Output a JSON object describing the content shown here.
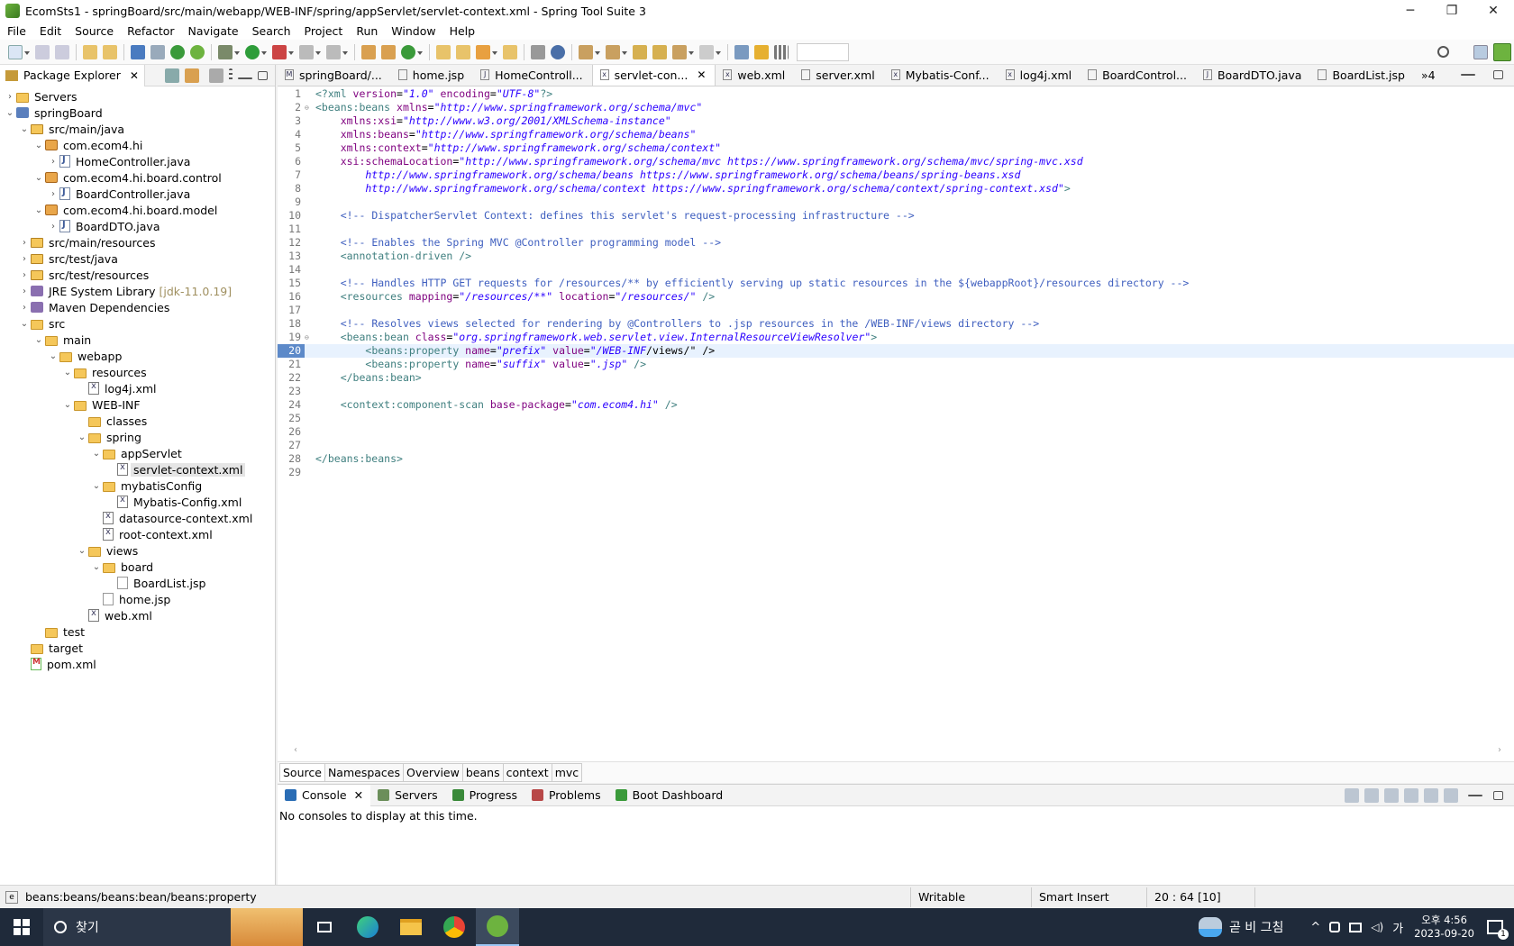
{
  "window": {
    "title": "EcomSts1 - springBoard/src/main/webapp/WEB-INF/spring/appServlet/servlet-context.xml - Spring Tool Suite 3",
    "minimize": "─",
    "maximize": "❐",
    "close": "✕"
  },
  "menu": [
    "File",
    "Edit",
    "Source",
    "Refactor",
    "Navigate",
    "Search",
    "Project",
    "Run",
    "Window",
    "Help"
  ],
  "explorer": {
    "title": "Package Explorer",
    "tree": [
      {
        "label": "Servers",
        "depth": 0,
        "twisty": "›",
        "icon": "folder"
      },
      {
        "label": "springBoard",
        "depth": 0,
        "twisty": "⌄",
        "icon": "proj"
      },
      {
        "label": "src/main/java",
        "depth": 1,
        "twisty": "⌄",
        "icon": "pkgfolder"
      },
      {
        "label": "com.ecom4.hi",
        "depth": 2,
        "twisty": "⌄",
        "icon": "pkg"
      },
      {
        "label": "HomeController.java",
        "depth": 3,
        "twisty": "›",
        "icon": "java"
      },
      {
        "label": "com.ecom4.hi.board.control",
        "depth": 2,
        "twisty": "⌄",
        "icon": "pkg"
      },
      {
        "label": "BoardController.java",
        "depth": 3,
        "twisty": "›",
        "icon": "java"
      },
      {
        "label": "com.ecom4.hi.board.model",
        "depth": 2,
        "twisty": "⌄",
        "icon": "pkg"
      },
      {
        "label": "BoardDTO.java",
        "depth": 3,
        "twisty": "›",
        "icon": "java"
      },
      {
        "label": "src/main/resources",
        "depth": 1,
        "twisty": "›",
        "icon": "pkgfolder"
      },
      {
        "label": "src/test/java",
        "depth": 1,
        "twisty": "›",
        "icon": "pkgfolder"
      },
      {
        "label": "src/test/resources",
        "depth": 1,
        "twisty": "›",
        "icon": "pkgfolder"
      },
      {
        "label": "JRE System Library",
        "dim": " [jdk-11.0.19]",
        "depth": 1,
        "twisty": "›",
        "icon": "lib"
      },
      {
        "label": "Maven Dependencies",
        "depth": 1,
        "twisty": "›",
        "icon": "lib"
      },
      {
        "label": "src",
        "depth": 1,
        "twisty": "⌄",
        "icon": "folder"
      },
      {
        "label": "main",
        "depth": 2,
        "twisty": "⌄",
        "icon": "folder"
      },
      {
        "label": "webapp",
        "depth": 3,
        "twisty": "⌄",
        "icon": "folder"
      },
      {
        "label": "resources",
        "depth": 4,
        "twisty": "⌄",
        "icon": "folder"
      },
      {
        "label": "log4j.xml",
        "depth": 5,
        "twisty": "",
        "icon": "xml"
      },
      {
        "label": "WEB-INF",
        "depth": 4,
        "twisty": "⌄",
        "icon": "folder"
      },
      {
        "label": "classes",
        "depth": 5,
        "twisty": "",
        "icon": "folder"
      },
      {
        "label": "spring",
        "depth": 5,
        "twisty": "⌄",
        "icon": "folder"
      },
      {
        "label": "appServlet",
        "depth": 6,
        "twisty": "⌄",
        "icon": "folder"
      },
      {
        "label": "servlet-context.xml",
        "depth": 7,
        "twisty": "",
        "icon": "xml",
        "selected": true
      },
      {
        "label": "mybatisConfig",
        "depth": 6,
        "twisty": "⌄",
        "icon": "folder"
      },
      {
        "label": "Mybatis-Config.xml",
        "depth": 7,
        "twisty": "",
        "icon": "xml"
      },
      {
        "label": "datasource-context.xml",
        "depth": 6,
        "twisty": "",
        "icon": "xml"
      },
      {
        "label": "root-context.xml",
        "depth": 6,
        "twisty": "",
        "icon": "xml"
      },
      {
        "label": "views",
        "depth": 5,
        "twisty": "⌄",
        "icon": "folder"
      },
      {
        "label": "board",
        "depth": 6,
        "twisty": "⌄",
        "icon": "folder"
      },
      {
        "label": "BoardList.jsp",
        "depth": 7,
        "twisty": "",
        "icon": "jsp"
      },
      {
        "label": "home.jsp",
        "depth": 6,
        "twisty": "",
        "icon": "jsp"
      },
      {
        "label": "web.xml",
        "depth": 5,
        "twisty": "",
        "icon": "xml"
      },
      {
        "label": "test",
        "depth": 2,
        "twisty": "",
        "icon": "folder"
      },
      {
        "label": "target",
        "depth": 1,
        "twisty": "",
        "icon": "folder"
      },
      {
        "label": "pom.xml",
        "depth": 1,
        "twisty": "",
        "icon": "pom"
      }
    ]
  },
  "editor": {
    "tabs": [
      {
        "label": "springBoard/...",
        "ic": "M"
      },
      {
        "label": "home.jsp",
        "ic": ""
      },
      {
        "label": "HomeControll...",
        "ic": "J"
      },
      {
        "label": "servlet-con...",
        "ic": "x",
        "active": true
      },
      {
        "label": "web.xml",
        "ic": "x"
      },
      {
        "label": "server.xml",
        "ic": ""
      },
      {
        "label": "Mybatis-Conf...",
        "ic": "x"
      },
      {
        "label": "log4j.xml",
        "ic": "x"
      },
      {
        "label": "BoardControl...",
        "ic": ""
      },
      {
        "label": "BoardDTO.java",
        "ic": "J"
      },
      {
        "label": "BoardList.jsp",
        "ic": ""
      }
    ],
    "overflow": "»4",
    "lines": [
      [
        [
          "pi",
          "<?xml "
        ],
        [
          "att",
          "version"
        ],
        [
          "tx",
          "="
        ],
        [
          "val",
          "\"1.0\""
        ],
        [
          "tx",
          " "
        ],
        [
          "att",
          "encoding"
        ],
        [
          "tx",
          "="
        ],
        [
          "val",
          "\"UTF-8\""
        ],
        [
          "pi",
          "?>"
        ]
      ],
      [
        [
          "tag",
          "<beans:beans "
        ],
        [
          "att",
          "xmlns"
        ],
        [
          "tx",
          "="
        ],
        [
          "val",
          "\"http://www.springframework.org/schema/mvc\""
        ]
      ],
      [
        [
          "tx",
          "    "
        ],
        [
          "att",
          "xmlns:xsi"
        ],
        [
          "tx",
          "="
        ],
        [
          "val",
          "\"http://www.w3.org/2001/XMLSchema-instance\""
        ]
      ],
      [
        [
          "tx",
          "    "
        ],
        [
          "att",
          "xmlns:beans"
        ],
        [
          "tx",
          "="
        ],
        [
          "val",
          "\"http://www.springframework.org/schema/beans\""
        ]
      ],
      [
        [
          "tx",
          "    "
        ],
        [
          "att",
          "xmlns:context"
        ],
        [
          "tx",
          "="
        ],
        [
          "val",
          "\"http://www.springframework.org/schema/context\""
        ]
      ],
      [
        [
          "tx",
          "    "
        ],
        [
          "att",
          "xsi:schemaLocation"
        ],
        [
          "tx",
          "="
        ],
        [
          "val",
          "\"http://www.springframework.org/schema/mvc https://www.springframework.org/schema/mvc/spring-mvc.xsd"
        ]
      ],
      [
        [
          "val",
          "        http://www.springframework.org/schema/beans https://www.springframework.org/schema/beans/spring-beans.xsd"
        ]
      ],
      [
        [
          "val",
          "        http://www.springframework.org/schema/context https://www.springframework.org/schema/context/spring-context.xsd\""
        ],
        [
          "tag",
          ">"
        ]
      ],
      [],
      [
        [
          "tx",
          "    "
        ],
        [
          "cmt",
          "<!-- DispatcherServlet Context: defines this servlet's request-processing infrastructure -->"
        ]
      ],
      [],
      [
        [
          "tx",
          "    "
        ],
        [
          "cmt",
          "<!-- Enables the Spring MVC @Controller programming model -->"
        ]
      ],
      [
        [
          "tx",
          "    "
        ],
        [
          "tag",
          "<annotation-driven />"
        ]
      ],
      [],
      [
        [
          "tx",
          "    "
        ],
        [
          "cmt",
          "<!-- Handles HTTP GET requests for /resources/** by efficiently serving up static resources in the ${webappRoot}/resources directory -->"
        ]
      ],
      [
        [
          "tx",
          "    "
        ],
        [
          "tag",
          "<resources "
        ],
        [
          "att",
          "mapping"
        ],
        [
          "tx",
          "="
        ],
        [
          "val",
          "\"/resources/**\""
        ],
        [
          "tx",
          " "
        ],
        [
          "att",
          "location"
        ],
        [
          "tx",
          "="
        ],
        [
          "val",
          "\"/resources/\""
        ],
        [
          "tag",
          " />"
        ]
      ],
      [],
      [
        [
          "tx",
          "    "
        ],
        [
          "cmt",
          "<!-- Resolves views selected for rendering by @Controllers to .jsp resources in the /WEB-INF/views directory -->"
        ]
      ],
      [
        [
          "tx",
          "    "
        ],
        [
          "tag",
          "<beans:bean "
        ],
        [
          "att",
          "class"
        ],
        [
          "tx",
          "="
        ],
        [
          "val",
          "\"org.springframework.web.servlet.view.InternalResourceViewResolver\""
        ],
        [
          "tag",
          ">"
        ]
      ],
      [
        [
          "tx",
          "        "
        ],
        [
          "tag",
          "<beans:property "
        ],
        [
          "att",
          "name"
        ],
        [
          "tx",
          "="
        ],
        [
          "val",
          "\"prefix\""
        ],
        [
          "tx",
          " "
        ],
        [
          "att",
          "value"
        ],
        [
          "tx",
          "="
        ],
        [
          "val",
          "\"/WEB-INF"
        ],
        [
          "hl",
          "/views/\" />"
        ]
      ],
      [
        [
          "tx",
          "        "
        ],
        [
          "tag",
          "<beans:property "
        ],
        [
          "att",
          "name"
        ],
        [
          "tx",
          "="
        ],
        [
          "val",
          "\"suffix\""
        ],
        [
          "tx",
          " "
        ],
        [
          "att",
          "value"
        ],
        [
          "tx",
          "="
        ],
        [
          "val",
          "\".jsp\""
        ],
        [
          "tag",
          " />"
        ]
      ],
      [
        [
          "tx",
          "    "
        ],
        [
          "tag",
          "</beans:bean>"
        ]
      ],
      [],
      [
        [
          "tx",
          "    "
        ],
        [
          "tag",
          "<context:component-scan "
        ],
        [
          "att",
          "base-package"
        ],
        [
          "tx",
          "="
        ],
        [
          "val",
          "\"com.ecom4.hi\""
        ],
        [
          "tag",
          " />"
        ]
      ],
      [],
      [],
      [],
      [
        [
          "tag",
          "</beans:beans>"
        ]
      ],
      []
    ],
    "current_line": 20,
    "fold_lines": [
      2,
      19
    ],
    "bottom_tabs": [
      "Source",
      "Namespaces",
      "Overview",
      "beans",
      "context",
      "mvc"
    ]
  },
  "console": {
    "tabs": [
      "Console",
      "Servers",
      "Progress",
      "Problems",
      "Boot Dashboard"
    ],
    "message": "No consoles to display at this time."
  },
  "status": {
    "path": "beans:beans/beans:bean/beans:property",
    "writable": "Writable",
    "insert": "Smart Insert",
    "position": "20 : 64 [10]"
  },
  "taskbar": {
    "search": "찾기",
    "weather": "곧 비 그침",
    "time": "오후 4:56",
    "date": "2023-09-20",
    "ime": "가",
    "notif": "1"
  }
}
